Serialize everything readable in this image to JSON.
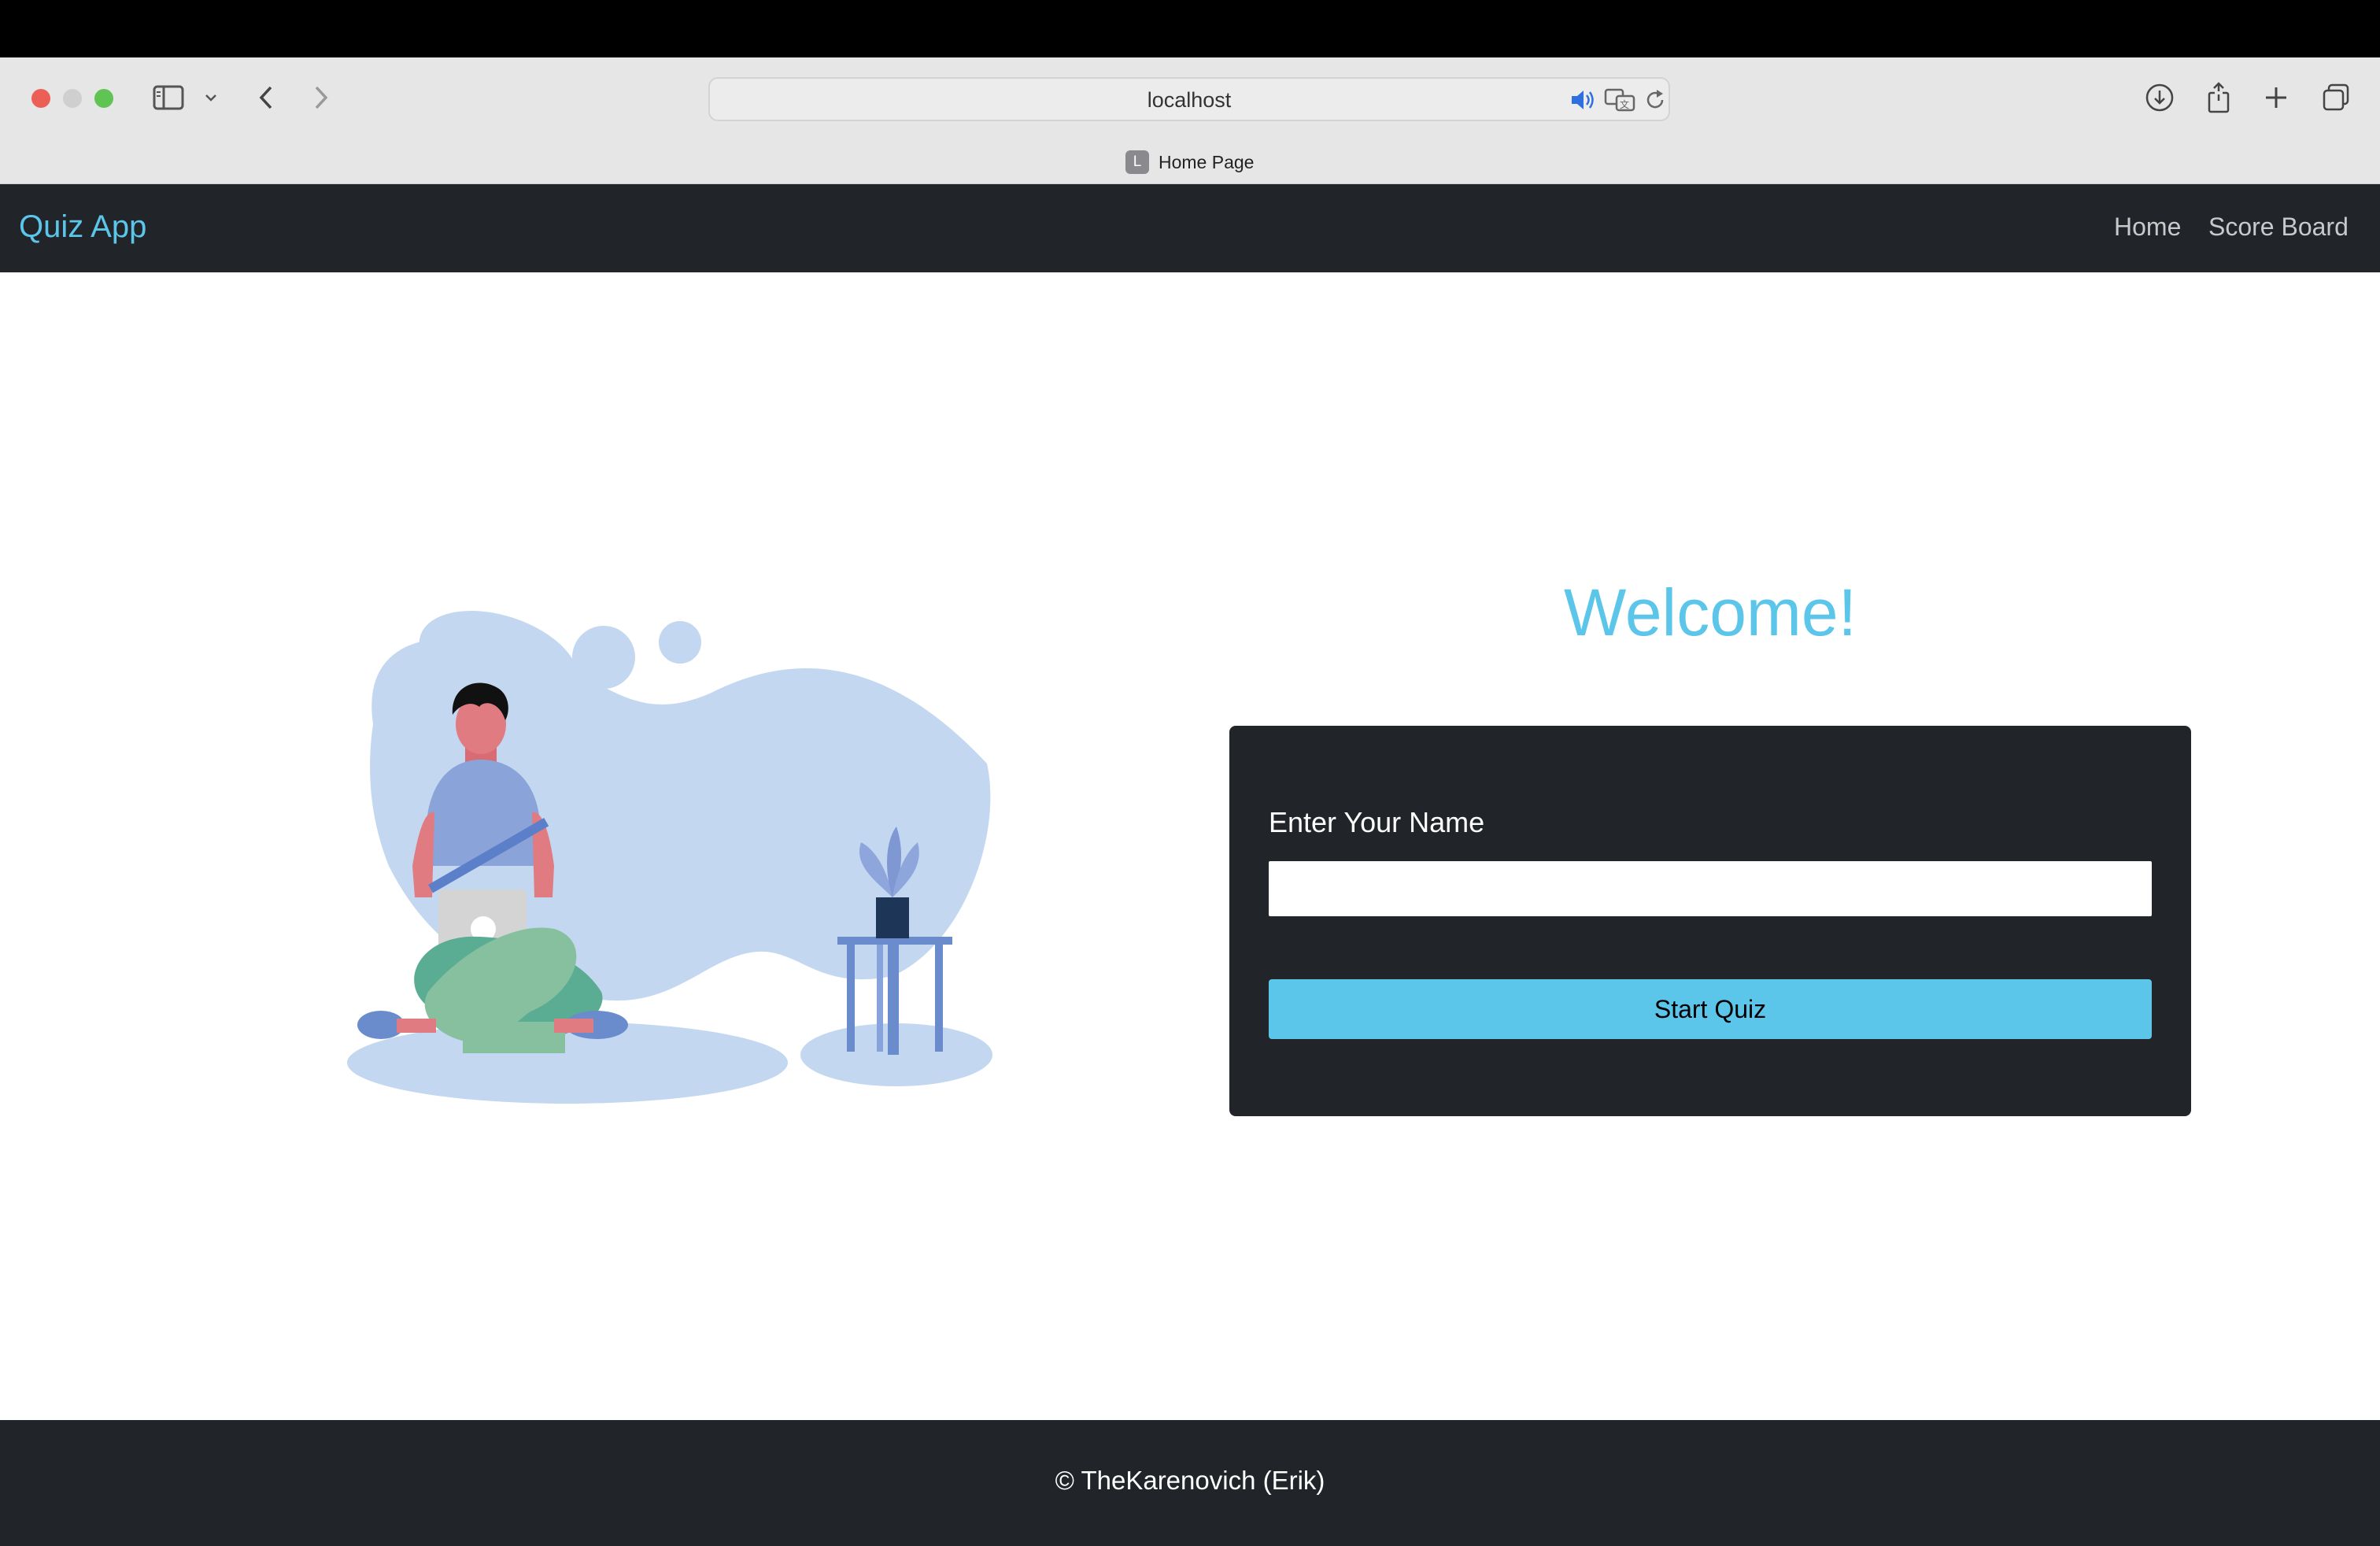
{
  "browser": {
    "url": "localhost",
    "tab_title": "Home Page",
    "favicon_letter": "L"
  },
  "navbar": {
    "brand": "Quiz App",
    "links": [
      "Home",
      "Score Board"
    ]
  },
  "main": {
    "welcome": "Welcome!",
    "form": {
      "label": "Enter Your Name",
      "input_value": "",
      "button_label": "Start Quiz"
    }
  },
  "footer": {
    "text": "© TheKarenovich (Erik)"
  },
  "colors": {
    "accent": "#5bc5ea",
    "dark": "#212529"
  }
}
